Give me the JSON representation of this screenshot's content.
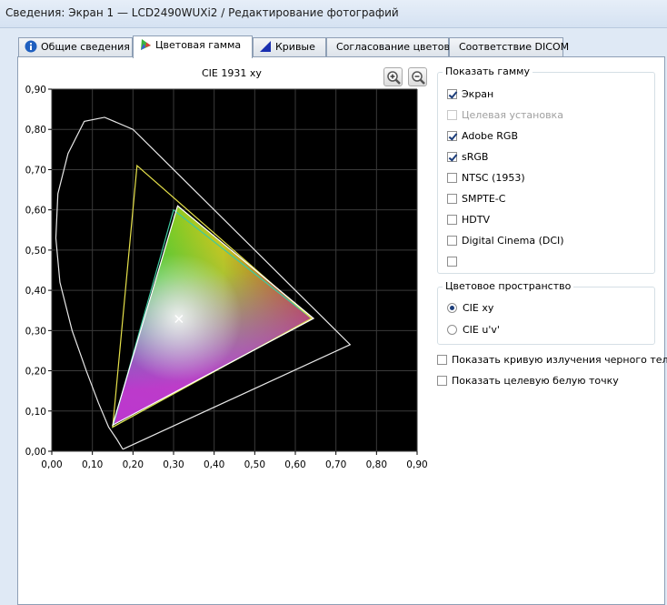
{
  "window": {
    "title": "Сведения: Экран 1 — LCD2490WUXi2 / Редактирование фотографий"
  },
  "tabs": [
    {
      "label": "Общие сведения"
    },
    {
      "label": "Цветовая гамма"
    },
    {
      "label": "Кривые"
    },
    {
      "label": "Согласование цветов"
    },
    {
      "label": "Соответствие DICOM"
    }
  ],
  "chart": {
    "title": "CIE 1931 xy"
  },
  "chart_data": {
    "type": "scatter",
    "title": "CIE 1931 xy",
    "xlabel": "",
    "ylabel": "",
    "xlim": [
      0.0,
      0.9
    ],
    "ylim": [
      0.0,
      0.9
    ],
    "grid": true,
    "x_ticks": [
      "0,00",
      "0,10",
      "0,20",
      "0,30",
      "0,40",
      "0,50",
      "0,60",
      "0,70",
      "0,80",
      "0,90"
    ],
    "y_ticks": [
      "0,00",
      "0,10",
      "0,20",
      "0,30",
      "0,40",
      "0,50",
      "0,60",
      "0,70",
      "0,80",
      "0,90"
    ],
    "series": [
      {
        "name": "Экран",
        "x": [
          0.31,
          0.645,
          0.15
        ],
        "y": [
          0.61,
          0.33,
          0.065
        ],
        "color": "#ffffff"
      },
      {
        "name": "Adobe RGB",
        "x": [
          0.21,
          0.64,
          0.15
        ],
        "y": [
          0.71,
          0.33,
          0.06
        ],
        "color": "#e6e14a"
      },
      {
        "name": "sRGB",
        "x": [
          0.3,
          0.64,
          0.15
        ],
        "y": [
          0.6,
          0.33,
          0.06
        ],
        "color": "#3fc9a0"
      }
    ],
    "white_point": {
      "x": 0.313,
      "y": 0.329
    },
    "spectral_locus": {
      "x": [
        0.175,
        0.16,
        0.14,
        0.115,
        0.085,
        0.05,
        0.02,
        0.01,
        0.015,
        0.04,
        0.08,
        0.13,
        0.2,
        0.28,
        0.36,
        0.44,
        0.52,
        0.59,
        0.65,
        0.7,
        0.735,
        0.175
      ],
      "y": [
        0.005,
        0.03,
        0.06,
        0.12,
        0.2,
        0.3,
        0.42,
        0.53,
        0.64,
        0.74,
        0.82,
        0.83,
        0.8,
        0.72,
        0.64,
        0.56,
        0.48,
        0.41,
        0.35,
        0.3,
        0.265,
        0.005
      ]
    }
  },
  "gamut_group": {
    "title": "Показать гамму",
    "items": [
      {
        "label": "Экран",
        "checked": true,
        "enabled": true
      },
      {
        "label": "Целевая установка",
        "checked": false,
        "enabled": false
      },
      {
        "label": "Adobe RGB",
        "checked": true,
        "enabled": true
      },
      {
        "label": "sRGB",
        "checked": true,
        "enabled": true
      },
      {
        "label": "NTSC (1953)",
        "checked": false,
        "enabled": true
      },
      {
        "label": "SMPTE-C",
        "checked": false,
        "enabled": true
      },
      {
        "label": "HDTV",
        "checked": false,
        "enabled": true
      },
      {
        "label": "Digital Cinema (DCI)",
        "checked": false,
        "enabled": true
      },
      {
        "label": "",
        "checked": false,
        "enabled": true
      }
    ]
  },
  "colorspace_group": {
    "title": "Цветовое пространство",
    "options": [
      {
        "label": "CIE xy",
        "selected": true
      },
      {
        "label": "CIE u'v'",
        "selected": false
      }
    ]
  },
  "extra_options": [
    {
      "label": "Показать кривую излучения черного тела",
      "checked": false
    },
    {
      "label": "Показать целевую белую точку",
      "checked": false
    }
  ]
}
